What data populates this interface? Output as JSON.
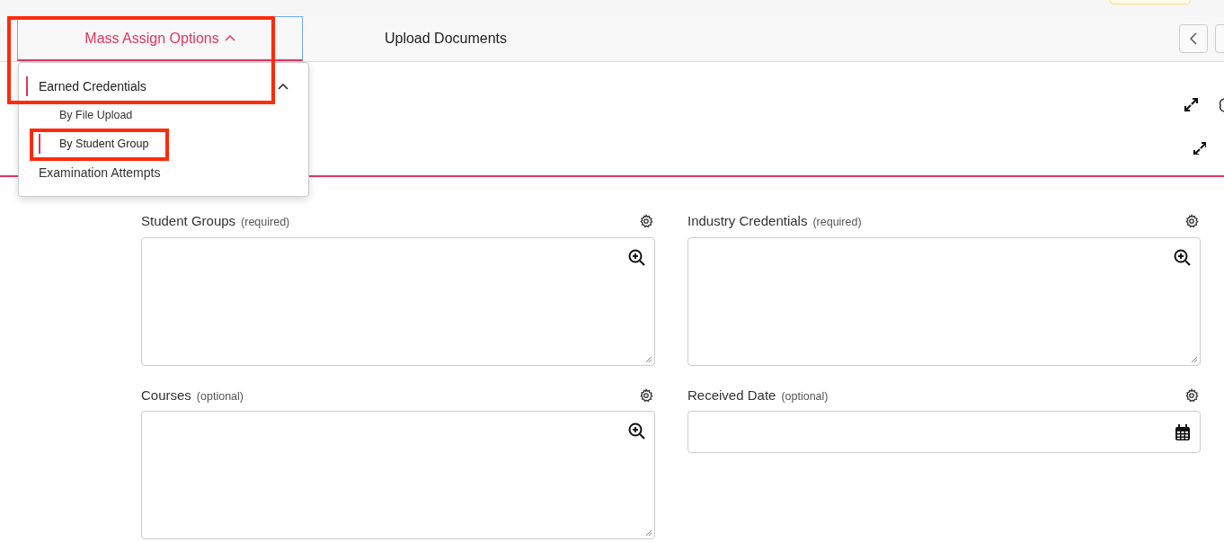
{
  "tabs": [
    {
      "label": "Mass Assign Options",
      "selected": true,
      "expanded": true,
      "highlighted": true
    },
    {
      "label": "Upload Documents",
      "selected": false,
      "highlighted": false
    }
  ],
  "menu": {
    "items": [
      {
        "label": "Earned Credentials",
        "selected": true,
        "expanded": true,
        "children": [
          {
            "label": "By File Upload",
            "selected": false,
            "highlighted": false
          },
          {
            "label": "By Student Group",
            "selected": true,
            "highlighted": true
          }
        ]
      },
      {
        "label": "Examination Attempts",
        "selected": false
      }
    ]
  },
  "fields": [
    {
      "label": "Student Groups",
      "note": "(required)",
      "kind": "lookup"
    },
    {
      "label": "Industry Credentials",
      "note": "(required)",
      "kind": "lookup"
    },
    {
      "label": "Courses",
      "note": "(optional)",
      "kind": "lookup"
    },
    {
      "label": "Received Date",
      "note": "(optional)",
      "kind": "date"
    }
  ]
}
